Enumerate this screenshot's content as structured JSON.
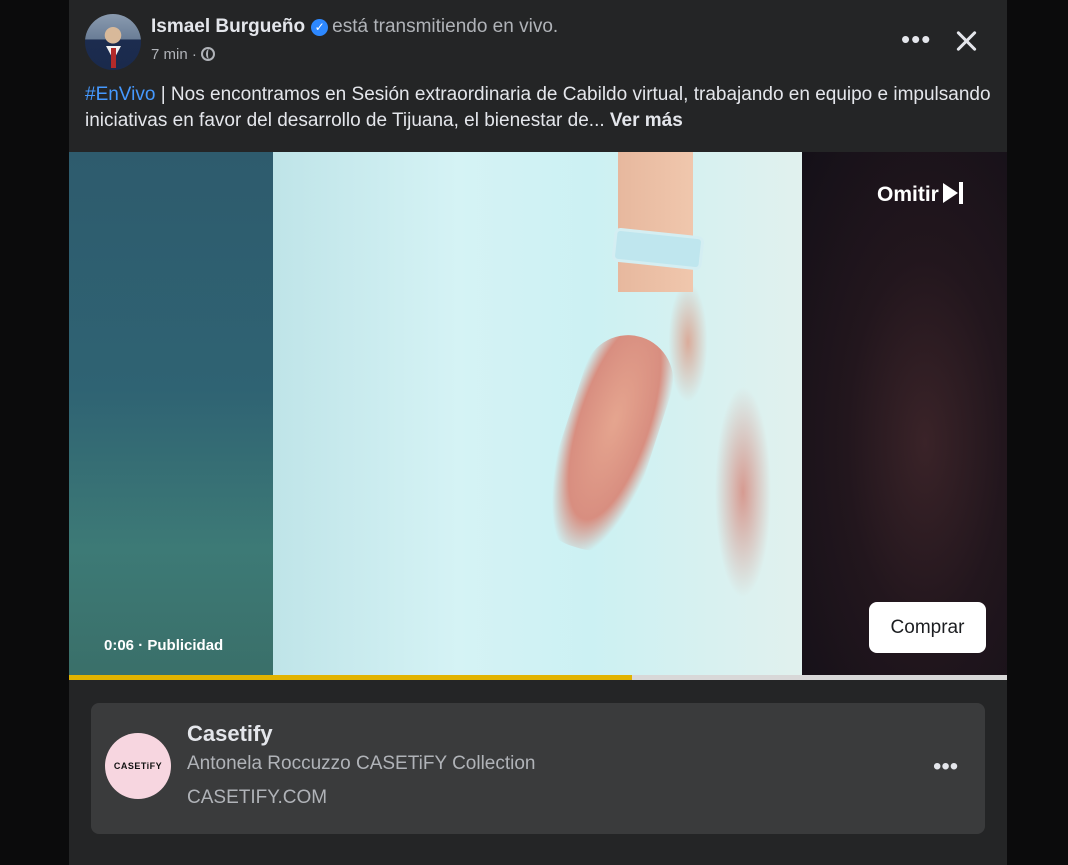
{
  "post": {
    "author": "Ismael Burgueño",
    "verified_icon": "verified-badge-icon",
    "status": "está transmitiendo en vivo.",
    "time": "7 min",
    "separator": "·",
    "audience_icon": "globe-icon",
    "hashtag": "#EnVivo",
    "text": " | Nos encontramos en Sesión extraordinaria de Cabildo virtual, trabajando en equipo e impulsando iniciativas en favor del desarrollo de Tijuana, el bienestar de... ",
    "see_more": "Ver más"
  },
  "header_actions": {
    "more_icon": "more-horizontal-icon",
    "close_icon": "close-icon"
  },
  "video_ad": {
    "skip_label": "Omitir",
    "skip_icon": "skip-next-icon",
    "elapsed": "0:06",
    "separator": "·",
    "ad_label": "Publicidad",
    "cta_label": "Comprar",
    "progress_fraction": 0.6,
    "progress_color": "#e2b300"
  },
  "advertiser": {
    "logo_text": "CASETiFY",
    "name": "Casetify",
    "description": "Antonela Roccuzzo CASETiFY Collection",
    "url": "CASETIFY.COM",
    "more_icon": "more-horizontal-icon"
  },
  "colors": {
    "link": "#4599ff",
    "background": "#242526",
    "verified": "#2d88ff"
  }
}
